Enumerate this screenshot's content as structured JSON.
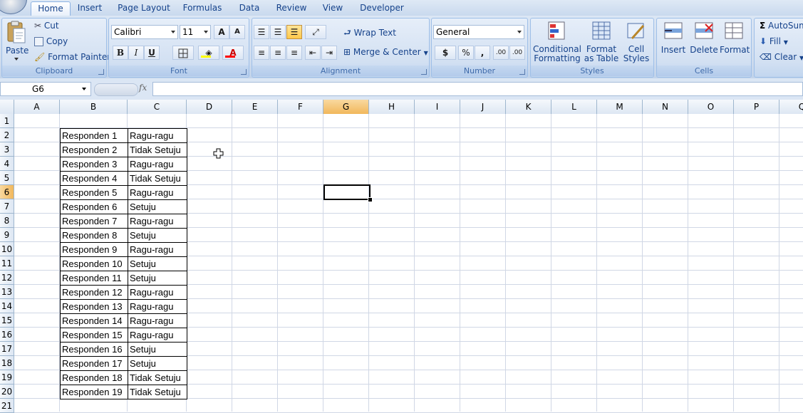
{
  "ribbon_tabs": [
    "Home",
    "Insert",
    "Page Layout",
    "Formulas",
    "Data",
    "Review",
    "View",
    "Developer"
  ],
  "clipboard": {
    "paste": "Paste",
    "cut": "Cut",
    "copy": "Copy",
    "format_painter": "Format Painter",
    "title": "Clipboard"
  },
  "font": {
    "name": "Calibri",
    "size": "11",
    "grow": "A",
    "shrink": "A",
    "bold": "B",
    "italic": "I",
    "underline": "U",
    "color_letter": "A",
    "title": "Font",
    "highlight_color": "#ffff00",
    "font_color": "#ff0000"
  },
  "alignment": {
    "wrap_text": "Wrap Text",
    "merge_center": "Merge & Center",
    "title": "Alignment"
  },
  "number": {
    "format": "General",
    "currency": "$",
    "percent": "%",
    "comma": ",",
    "inc_decimal": ".00",
    "dec_decimal": ".00",
    "title": "Number"
  },
  "styles": {
    "conditional": "Conditional",
    "formatting": "Formatting",
    "format": "Format",
    "as_table": "as Table",
    "cell": "Cell",
    "cell_styles": "Styles",
    "title": "Styles"
  },
  "cells": {
    "insert": "Insert",
    "delete": "Delete",
    "format": "Format",
    "title": "Cells"
  },
  "editing": {
    "autosum": "AutoSum",
    "fill": "Fill",
    "clear": "Clear"
  },
  "formula_bar": {
    "name_box": "G6",
    "fx": "fx",
    "formula": ""
  },
  "columns": [
    "A",
    "B",
    "C",
    "D",
    "E",
    "F",
    "G",
    "H",
    "I",
    "J",
    "K",
    "L",
    "M",
    "N",
    "O",
    "P",
    "Q"
  ],
  "selected_column": "G",
  "selected_row": 6,
  "rows": [
    1,
    2,
    3,
    4,
    5,
    6,
    7,
    8,
    9,
    10,
    11,
    12,
    13,
    14,
    15,
    16,
    17,
    18,
    19,
    20,
    21
  ],
  "table": [
    {
      "b": "Responden 1",
      "c": "Ragu-ragu"
    },
    {
      "b": "Responden 2",
      "c": "Tidak Setuju"
    },
    {
      "b": "Responden 3",
      "c": "Ragu-ragu"
    },
    {
      "b": "Responden 4",
      "c": "Tidak Setuju"
    },
    {
      "b": "Responden 5",
      "c": "Ragu-ragu"
    },
    {
      "b": "Responden 6",
      "c": "Setuju"
    },
    {
      "b": "Responden 7",
      "c": "Ragu-ragu"
    },
    {
      "b": "Responden 8",
      "c": "Setuju"
    },
    {
      "b": "Responden 9",
      "c": "Ragu-ragu"
    },
    {
      "b": "Responden 10",
      "c": "Setuju"
    },
    {
      "b": "Responden 11",
      "c": "Setuju"
    },
    {
      "b": "Responden 12",
      "c": "Ragu-ragu"
    },
    {
      "b": "Responden 13",
      "c": "Ragu-ragu"
    },
    {
      "b": "Responden 14",
      "c": "Ragu-ragu"
    },
    {
      "b": "Responden 15",
      "c": "Ragu-ragu"
    },
    {
      "b": "Responden 16",
      "c": "Setuju"
    },
    {
      "b": "Responden 17",
      "c": "Setuju"
    },
    {
      "b": "Responden 18",
      "c": "Tidak Setuju"
    },
    {
      "b": "Responden 19",
      "c": "Tidak Setuju"
    }
  ]
}
